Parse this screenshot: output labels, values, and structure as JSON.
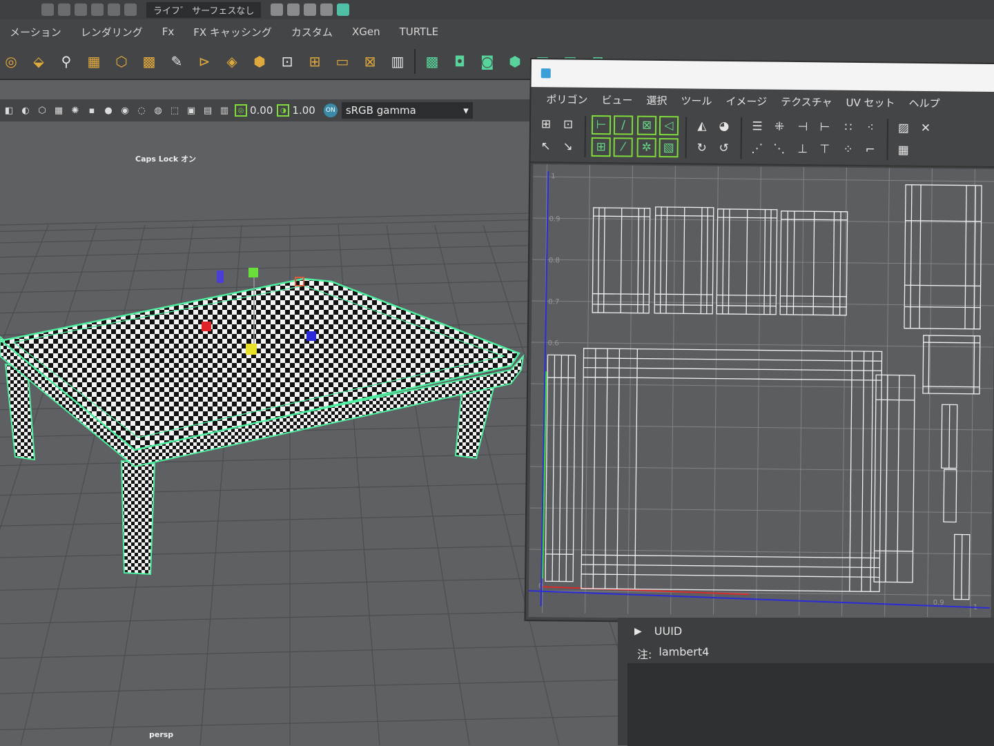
{
  "status_strip": {
    "live_surface": "ライフ゛ サーフェスなし"
  },
  "shelf_tabs": [
    "メーション",
    "レンダリング",
    "Fx",
    "FX キャッシング",
    "カスタム",
    "XGen",
    "TURTLE"
  ],
  "shelf_icons": {
    "main": [
      "uv-icon",
      "cube-uv-icon",
      "cut-icon",
      "layout-icon",
      "cube-icon",
      "checker-icon",
      "paint-icon",
      "sew-icon",
      "layer-icon",
      "box-icon",
      "frame-icon",
      "grid-icon",
      "rect-icon",
      "cross-icon",
      "tiles-icon"
    ],
    "green": [
      "green-a-icon",
      "green-b-icon",
      "green-c-icon",
      "green-d-icon",
      "green-e-icon",
      "green-f-icon",
      "green-g-icon"
    ]
  },
  "viewport_toolbar": {
    "value_a": "0.00",
    "value_b": "1.00",
    "color_space": "sRGB gamma"
  },
  "viewport": {
    "caps_lock": "Caps Lock オン",
    "camera": "persp",
    "grid_color": "#4a4c4f",
    "wire_color": "#4ef0a0"
  },
  "uv_editor": {
    "menu": [
      "ポリゴン",
      "ビュー",
      "選択",
      "ツール",
      "イメージ",
      "テクスチャ",
      "UV セット",
      "ヘルプ"
    ],
    "axis_labels": [
      "1",
      "0.9",
      "0.8",
      "0.7",
      "0.6",
      "0"
    ],
    "bottom_labels": [
      "0.9",
      "1"
    ]
  },
  "attributes": {
    "uuid_label": "UUID",
    "notes_label": "注:",
    "notes_value": "lambert4"
  }
}
